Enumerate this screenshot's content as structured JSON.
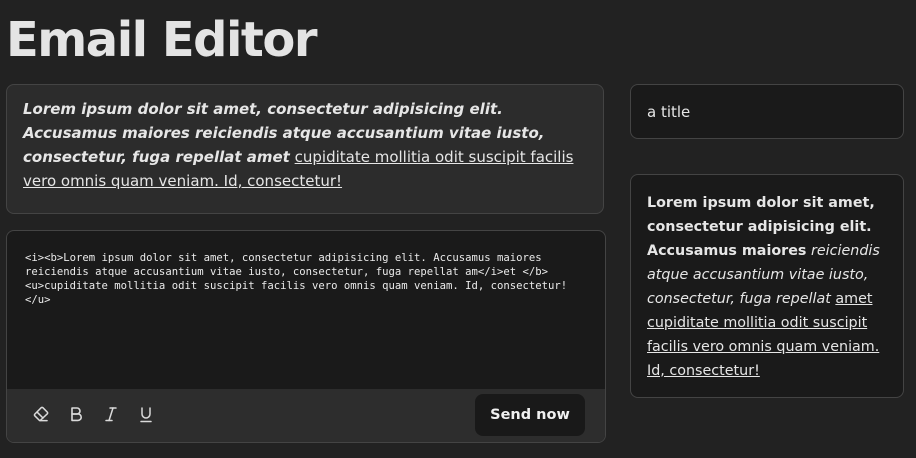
{
  "header": {
    "title": "Email Editor"
  },
  "preview": {
    "bold_italic_text": "Lorem ipsum dolor sit amet, consectetur adipisicing elit. Accusamus maiores reiciendis atque accusantium vitae iusto, consectetur, fuga repellat amet",
    "underline_text": "cupiditate mollitia odit suscipit facilis vero omnis quam veniam. Id, consectetur!"
  },
  "editor": {
    "source": "<i><b>Lorem ipsum dolor sit amet, consectetur adipisicing elit. Accusamus maiores reiciendis atque accusantium vitae iusto, consectetur, fuga repellat am</i>et </b><u>cupiditate mollitia odit suscipit facilis vero omnis quam veniam. Id, consectetur!</u>"
  },
  "toolbar": {
    "tools": [
      {
        "name": "eraser-icon",
        "label": "Clear formatting"
      },
      {
        "name": "bold-icon",
        "label": "B"
      },
      {
        "name": "italic-icon",
        "label": "I"
      },
      {
        "name": "underline-icon",
        "label": "U"
      }
    ],
    "send_label": "Send now"
  },
  "subject": {
    "value": "a title"
  },
  "side_preview": {
    "bold_text": "Lorem ipsum dolor sit amet, consectetur adipisicing elit. Accusamus maiores",
    "italic_text": "reiciendis atque accusantium vitae iusto, consectetur, fuga repellat",
    "underline_text": "amet cupiditate mollitia odit suscipit facilis vero omnis quam veniam. Id, consectetur!"
  },
  "colors": {
    "background": "#222222",
    "card": "#2c2c2c",
    "input": "#1a1a1a",
    "border": "#444444",
    "text": "#e6e6e6"
  }
}
